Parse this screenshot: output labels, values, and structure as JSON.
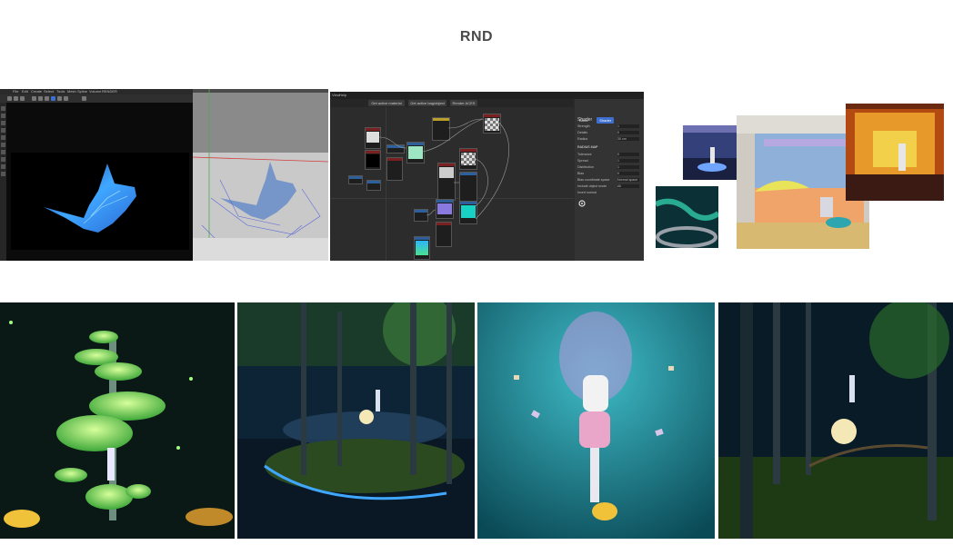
{
  "page": {
    "title": "RND"
  },
  "c4d_window": {
    "menu": [
      "File",
      "Edit",
      "Create",
      "Select",
      "Tools",
      "Mesh",
      "Spline",
      "Volume",
      "MoGraph",
      "Character",
      "Animate",
      "Simulate",
      "Tracker",
      "Render",
      "Extensions",
      "Window",
      "Help"
    ],
    "toolbar_value": "RENDER"
  },
  "node_editor": {
    "menu": [
      "View",
      "Help"
    ],
    "buttons": [
      "Get active material",
      "Get active bag/object",
      "Render ACES"
    ],
    "tabs": [
      "Basic",
      "Shader"
    ],
    "panel_title": "Shader",
    "section": "RADIUS MAP",
    "rows": [
      "Strength",
      "Details",
      "Radius",
      "Tolerance",
      "Spread",
      "Distribution",
      "Bias",
      "Bias coordinate space",
      "Include object mode",
      "Invert normal"
    ],
    "row_values": [
      "1",
      "0",
      "30 cm",
      "0",
      "1",
      "1",
      "0",
      "Normal space",
      "All",
      ""
    ]
  },
  "colors": {
    "title": "#4a4a4a",
    "accent": "#3d6fd0",
    "mushroom_glow": "#8bff6a",
    "ray_blue": "#3fa7ff"
  }
}
